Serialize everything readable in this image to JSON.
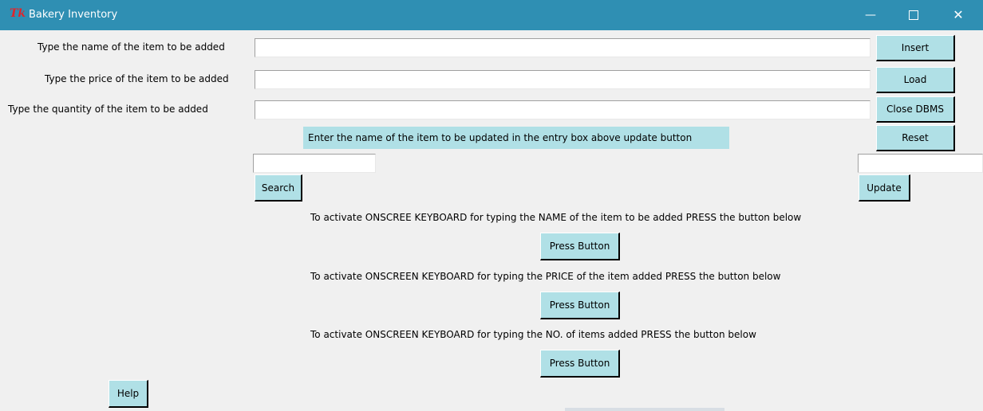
{
  "window": {
    "title": "Bakery Inventory",
    "icon": "tk-feather-icon",
    "controls": {
      "minimize": "—",
      "close": "✕"
    }
  },
  "form": {
    "name_label": "Type the name of the item to be added",
    "price_label": "Type the price of the item to be added",
    "quantity_label": "Type the quantity of the item to be added",
    "name_value": "",
    "price_value": "",
    "quantity_value": ""
  },
  "buttons": {
    "insert": "Insert",
    "load": "Load",
    "close_dbms": "Close DBMS",
    "reset": "Reset",
    "search": "Search",
    "update": "Update",
    "help": "Help",
    "press": "Press Button"
  },
  "update_hint": "Enter the name of the item to be updated in the entry box above update button",
  "search_value": "",
  "update_value": "",
  "keyboard": {
    "name_text": "To activate ONSCREE KEYBOARD for typing the NAME of the item to be added PRESS the button below",
    "price_text": "To activate ONSCREEN KEYBOARD for typing the PRICE of the item added PRESS the button below",
    "qty_text": "To activate ONSCREEN KEYBOARD for typing the NO. of items added PRESS the button below"
  },
  "colors": {
    "titlebar": "#2f8fb3",
    "button_bg": "#b0e0e6",
    "window_bg": "#f0f0f0"
  }
}
